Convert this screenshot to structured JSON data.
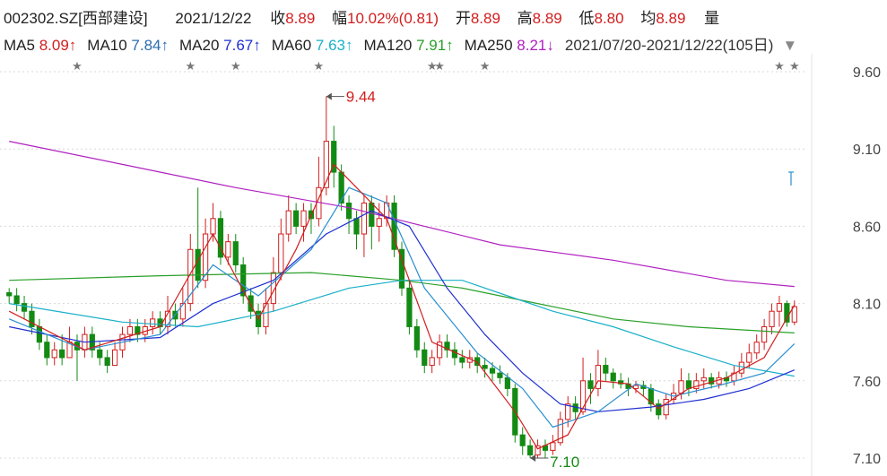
{
  "header": {
    "symbol": "002302.SZ[西部建设]",
    "date": "2021/12/22",
    "close_label": "收",
    "close": "8.89",
    "change_label": "幅",
    "change": "10.02%(0.81)",
    "open_label": "开",
    "open": "8.89",
    "high_label": "高",
    "high": "8.89",
    "low_label": "低",
    "low": "8.80",
    "avg_label": "均",
    "avg": "8.89",
    "vol_label": "量"
  },
  "ma_legend": [
    {
      "label": "MA5",
      "value": "8.09↑",
      "color": "#d21e1e"
    },
    {
      "label": "MA10",
      "value": "7.84↑",
      "color": "#2b6cb0"
    },
    {
      "label": "MA20",
      "value": "7.67↑",
      "color": "#1f2fd0"
    },
    {
      "label": "MA60",
      "value": "7.63↑",
      "color": "#1ab0c8"
    },
    {
      "label": "MA120",
      "value": "7.91↑",
      "color": "#2aa02a"
    },
    {
      "label": "MA250",
      "value": "8.21↓",
      "color": "#b020c0"
    }
  ],
  "range_text": "2021/07/20-2021/12/22(105日)",
  "colors": {
    "up": "#d21e1e",
    "down": "#138a13",
    "grid": "#d8d8d8"
  },
  "chart_data": {
    "type": "candlestick",
    "ylim": [
      7.1,
      9.7
    ],
    "yticks": [
      "9.60",
      "9.10",
      "8.60",
      "8.10",
      "7.60",
      "7.10"
    ],
    "high_marker": "9.44",
    "low_marker": "7.10",
    "candles": [
      [
        8.17,
        8.15,
        8.2,
        8.1
      ],
      [
        8.15,
        8.1,
        8.2,
        8.05
      ],
      [
        8.1,
        8.05,
        8.15,
        8.0
      ],
      [
        8.05,
        7.95,
        8.1,
        7.9
      ],
      [
        7.95,
        7.85,
        8.0,
        7.8
      ],
      [
        7.85,
        7.75,
        7.9,
        7.7
      ],
      [
        7.75,
        7.8,
        7.85,
        7.7
      ],
      [
        7.8,
        7.75,
        7.9,
        7.7
      ],
      [
        7.75,
        7.85,
        7.95,
        7.75
      ],
      [
        7.85,
        7.8,
        7.9,
        7.6
      ],
      [
        7.8,
        7.9,
        7.95,
        7.75
      ],
      [
        7.9,
        7.8,
        7.95,
        7.75
      ],
      [
        7.8,
        7.75,
        7.85,
        7.7
      ],
      [
        7.75,
        7.7,
        7.8,
        7.65
      ],
      [
        7.7,
        7.8,
        7.85,
        7.7
      ],
      [
        7.8,
        7.9,
        7.95,
        7.75
      ],
      [
        7.9,
        7.95,
        8.0,
        7.85
      ],
      [
        7.95,
        7.9,
        8.0,
        7.85
      ],
      [
        7.9,
        7.95,
        8.0,
        7.85
      ],
      [
        7.95,
        8.0,
        8.05,
        7.9
      ],
      [
        8.0,
        7.95,
        8.05,
        7.9
      ],
      [
        7.95,
        8.05,
        8.15,
        7.9
      ],
      [
        8.05,
        8.0,
        8.1,
        7.95
      ],
      [
        8.0,
        8.1,
        8.2,
        7.95
      ],
      [
        8.1,
        8.45,
        8.55,
        8.05
      ],
      [
        8.45,
        8.25,
        8.85,
        8.2
      ],
      [
        8.25,
        8.55,
        8.65,
        8.2
      ],
      [
        8.55,
        8.65,
        8.75,
        8.5
      ],
      [
        8.65,
        8.4,
        8.7,
        8.35
      ],
      [
        8.4,
        8.5,
        8.55,
        8.35
      ],
      [
        8.5,
        8.35,
        8.55,
        8.3
      ],
      [
        8.35,
        8.15,
        8.4,
        8.1
      ],
      [
        8.15,
        8.05,
        8.2,
        8.0
      ],
      [
        8.05,
        7.95,
        8.1,
        7.9
      ],
      [
        7.95,
        8.1,
        8.2,
        7.9
      ],
      [
        8.1,
        8.3,
        8.4,
        8.05
      ],
      [
        8.3,
        8.55,
        8.65,
        8.25
      ],
      [
        8.55,
        8.7,
        8.8,
        8.5
      ],
      [
        8.7,
        8.6,
        8.75,
        8.55
      ],
      [
        8.6,
        8.7,
        8.75,
        8.5
      ],
      [
        8.7,
        8.65,
        8.75,
        8.55
      ],
      [
        8.65,
        8.85,
        9.05,
        8.6
      ],
      [
        8.85,
        9.15,
        9.44,
        8.8
      ],
      [
        9.15,
        8.95,
        9.25,
        8.85
      ],
      [
        8.95,
        8.75,
        9.0,
        8.7
      ],
      [
        8.75,
        8.65,
        8.8,
        8.55
      ],
      [
        8.65,
        8.55,
        8.7,
        8.45
      ],
      [
        8.55,
        8.75,
        8.8,
        8.4
      ],
      [
        8.75,
        8.6,
        8.8,
        8.45
      ],
      [
        8.6,
        8.65,
        8.75,
        8.5
      ],
      [
        8.65,
        8.75,
        8.8,
        8.6
      ],
      [
        8.75,
        8.45,
        8.8,
        8.4
      ],
      [
        8.45,
        8.2,
        8.5,
        8.15
      ],
      [
        8.2,
        7.95,
        8.25,
        7.9
      ],
      [
        7.95,
        7.8,
        8.0,
        7.75
      ],
      [
        7.8,
        7.7,
        7.85,
        7.65
      ],
      [
        7.7,
        7.75,
        7.8,
        7.65
      ],
      [
        7.75,
        7.85,
        7.9,
        7.7
      ],
      [
        7.85,
        7.8,
        7.9,
        7.75
      ],
      [
        7.8,
        7.75,
        7.85,
        7.7
      ],
      [
        7.75,
        7.72,
        7.8,
        7.68
      ],
      [
        7.72,
        7.75,
        7.8,
        7.68
      ],
      [
        7.75,
        7.7,
        7.78,
        7.65
      ],
      [
        7.7,
        7.68,
        7.75,
        7.62
      ],
      [
        7.68,
        7.65,
        7.72,
        7.6
      ],
      [
        7.65,
        7.62,
        7.7,
        7.58
      ],
      [
        7.62,
        7.55,
        7.65,
        7.5
      ],
      [
        7.55,
        7.25,
        7.58,
        7.2
      ],
      [
        7.25,
        7.18,
        7.3,
        7.12
      ],
      [
        7.18,
        7.12,
        7.22,
        7.1
      ],
      [
        7.12,
        7.18,
        7.22,
        7.1
      ],
      [
        7.18,
        7.15,
        7.22,
        7.1
      ],
      [
        7.15,
        7.2,
        7.25,
        7.12
      ],
      [
        7.2,
        7.35,
        7.4,
        7.18
      ],
      [
        7.35,
        7.45,
        7.5,
        7.3
      ],
      [
        7.45,
        7.4,
        7.5,
        7.35
      ],
      [
        7.4,
        7.6,
        7.75,
        7.38
      ],
      [
        7.6,
        7.55,
        7.65,
        7.45
      ],
      [
        7.55,
        7.7,
        7.8,
        7.5
      ],
      [
        7.7,
        7.65,
        7.75,
        7.6
      ],
      [
        7.65,
        7.6,
        7.68,
        7.55
      ],
      [
        7.6,
        7.58,
        7.65,
        7.55
      ],
      [
        7.58,
        7.55,
        7.62,
        7.5
      ],
      [
        7.55,
        7.57,
        7.6,
        7.52
      ],
      [
        7.57,
        7.55,
        7.6,
        7.5
      ],
      [
        7.55,
        7.45,
        7.58,
        7.4
      ],
      [
        7.45,
        7.38,
        7.48,
        7.35
      ],
      [
        7.38,
        7.48,
        7.52,
        7.35
      ],
      [
        7.48,
        7.52,
        7.58,
        7.45
      ],
      [
        7.52,
        7.6,
        7.68,
        7.48
      ],
      [
        7.6,
        7.55,
        7.65,
        7.5
      ],
      [
        7.55,
        7.6,
        7.65,
        7.52
      ],
      [
        7.6,
        7.62,
        7.68,
        7.55
      ],
      [
        7.62,
        7.58,
        7.65,
        7.55
      ],
      [
        7.58,
        7.62,
        7.66,
        7.55
      ],
      [
        7.62,
        7.6,
        7.66,
        7.56
      ],
      [
        7.6,
        7.65,
        7.7,
        7.57
      ],
      [
        7.65,
        7.72,
        7.78,
        7.62
      ],
      [
        7.72,
        7.78,
        7.84,
        7.68
      ],
      [
        7.78,
        7.85,
        7.9,
        7.74
      ],
      [
        7.85,
        7.95,
        8.0,
        7.8
      ],
      [
        7.95,
        8.05,
        8.1,
        7.9
      ],
      [
        8.05,
        8.1,
        8.15,
        7.95
      ],
      [
        8.1,
        7.98,
        8.12,
        7.95
      ],
      [
        7.98,
        8.08,
        8.12,
        7.96
      ]
    ],
    "ma5": [
      [
        0,
        8.05
      ],
      [
        10,
        7.8
      ],
      [
        20,
        7.95
      ],
      [
        27,
        8.55
      ],
      [
        33,
        8.0
      ],
      [
        38,
        8.45
      ],
      [
        43,
        9.0
      ],
      [
        50,
        8.65
      ],
      [
        56,
        7.85
      ],
      [
        62,
        7.72
      ],
      [
        67,
        7.4
      ],
      [
        70,
        7.16
      ],
      [
        74,
        7.25
      ],
      [
        78,
        7.6
      ],
      [
        82,
        7.58
      ],
      [
        86,
        7.42
      ],
      [
        90,
        7.55
      ],
      [
        95,
        7.62
      ],
      [
        100,
        7.75
      ],
      [
        104,
        8.09
      ]
    ],
    "ma10": [
      [
        0,
        8.0
      ],
      [
        10,
        7.8
      ],
      [
        20,
        7.9
      ],
      [
        27,
        8.35
      ],
      [
        33,
        8.15
      ],
      [
        40,
        8.45
      ],
      [
        45,
        8.85
      ],
      [
        50,
        8.75
      ],
      [
        55,
        8.2
      ],
      [
        62,
        7.78
      ],
      [
        68,
        7.55
      ],
      [
        72,
        7.3
      ],
      [
        78,
        7.4
      ],
      [
        83,
        7.58
      ],
      [
        88,
        7.5
      ],
      [
        94,
        7.57
      ],
      [
        100,
        7.65
      ],
      [
        104,
        7.84
      ]
    ],
    "ma20": [
      [
        0,
        7.95
      ],
      [
        10,
        7.85
      ],
      [
        20,
        7.88
      ],
      [
        27,
        8.1
      ],
      [
        35,
        8.25
      ],
      [
        42,
        8.55
      ],
      [
        48,
        8.7
      ],
      [
        53,
        8.6
      ],
      [
        58,
        8.2
      ],
      [
        63,
        7.9
      ],
      [
        68,
        7.65
      ],
      [
        73,
        7.45
      ],
      [
        78,
        7.4
      ],
      [
        85,
        7.43
      ],
      [
        92,
        7.48
      ],
      [
        98,
        7.55
      ],
      [
        104,
        7.67
      ]
    ],
    "ma60": [
      [
        0,
        8.1
      ],
      [
        15,
        7.98
      ],
      [
        25,
        7.95
      ],
      [
        35,
        8.05
      ],
      [
        45,
        8.2
      ],
      [
        52,
        8.25
      ],
      [
        60,
        8.25
      ],
      [
        66,
        8.15
      ],
      [
        72,
        8.05
      ],
      [
        80,
        7.95
      ],
      [
        88,
        7.82
      ],
      [
        96,
        7.7
      ],
      [
        104,
        7.63
      ]
    ],
    "ma120": [
      [
        0,
        8.25
      ],
      [
        20,
        8.28
      ],
      [
        40,
        8.3
      ],
      [
        52,
        8.25
      ],
      [
        60,
        8.2
      ],
      [
        70,
        8.1
      ],
      [
        80,
        8.0
      ],
      [
        90,
        7.95
      ],
      [
        104,
        7.91
      ]
    ],
    "ma250": [
      [
        0,
        9.15
      ],
      [
        15,
        9.0
      ],
      [
        30,
        8.85
      ],
      [
        45,
        8.72
      ],
      [
        55,
        8.6
      ],
      [
        65,
        8.48
      ],
      [
        80,
        8.38
      ],
      [
        95,
        8.25
      ],
      [
        104,
        8.21
      ]
    ],
    "star_positions": [
      9,
      24,
      30,
      41,
      56,
      57,
      63,
      102,
      104
    ]
  }
}
